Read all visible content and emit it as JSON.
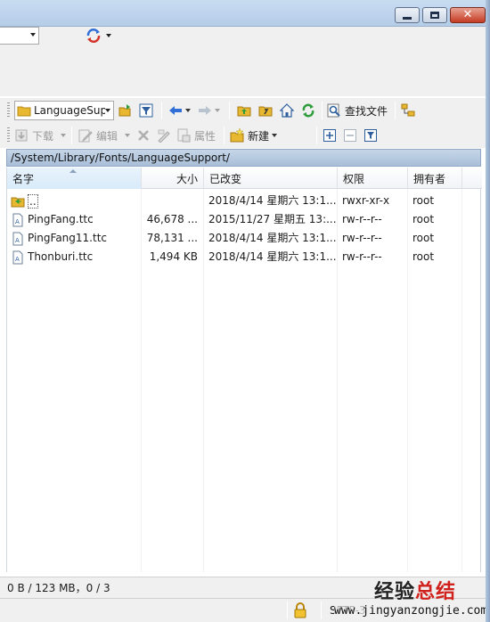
{
  "window": {
    "minimize_glyph": "—",
    "maximize_glyph": "□",
    "close_glyph": "✕"
  },
  "toolbar1": {
    "path_combo_value": "LanguageSup",
    "find_files_label": "查找文件"
  },
  "toolbar2": {
    "download_label": "下载",
    "edit_label": "编辑",
    "properties_label": "属性",
    "new_label": "新建"
  },
  "current_path": "/System/Library/Fonts/LanguageSupport/",
  "columns": {
    "name": "名字",
    "size": "大小",
    "modified": "已改变",
    "permissions": "权限",
    "owner": "拥有者"
  },
  "files": [
    {
      "name": "..",
      "size": "",
      "modified": "2018/4/14 星期六 13:1...",
      "permissions": "rwxr-xr-x",
      "owner": "root",
      "icon": "parent-folder-icon"
    },
    {
      "name": "PingFang.ttc",
      "size": "46,678 ...",
      "modified": "2015/11/27 星期五 13:...",
      "permissions": "rw-r--r--",
      "owner": "root",
      "icon": "file-icon"
    },
    {
      "name": "PingFang11.ttc",
      "size": "78,131 ...",
      "modified": "2018/4/14 星期六 13:1...",
      "permissions": "rw-r--r--",
      "owner": "root",
      "icon": "file-icon"
    },
    {
      "name": "Thonburi.ttc",
      "size": "1,494 KB",
      "modified": "2018/4/14 星期六 13:1...",
      "permissions": "rw-r--r--",
      "owner": "root",
      "icon": "file-icon"
    }
  ],
  "status": {
    "selection_info": "0 B / 123 MB，0 / 3",
    "protocol": "SFTP-3"
  },
  "watermark": {
    "brand_part1": "经验",
    "brand_part2": "总结",
    "url": "www.jingyanzongjie.com"
  },
  "colors": {
    "accent_blue": "#2f6fd6",
    "folder_yellow": "#e8b830",
    "refresh_green": "#2e9e3c",
    "watermark_red": "#d0211c"
  }
}
